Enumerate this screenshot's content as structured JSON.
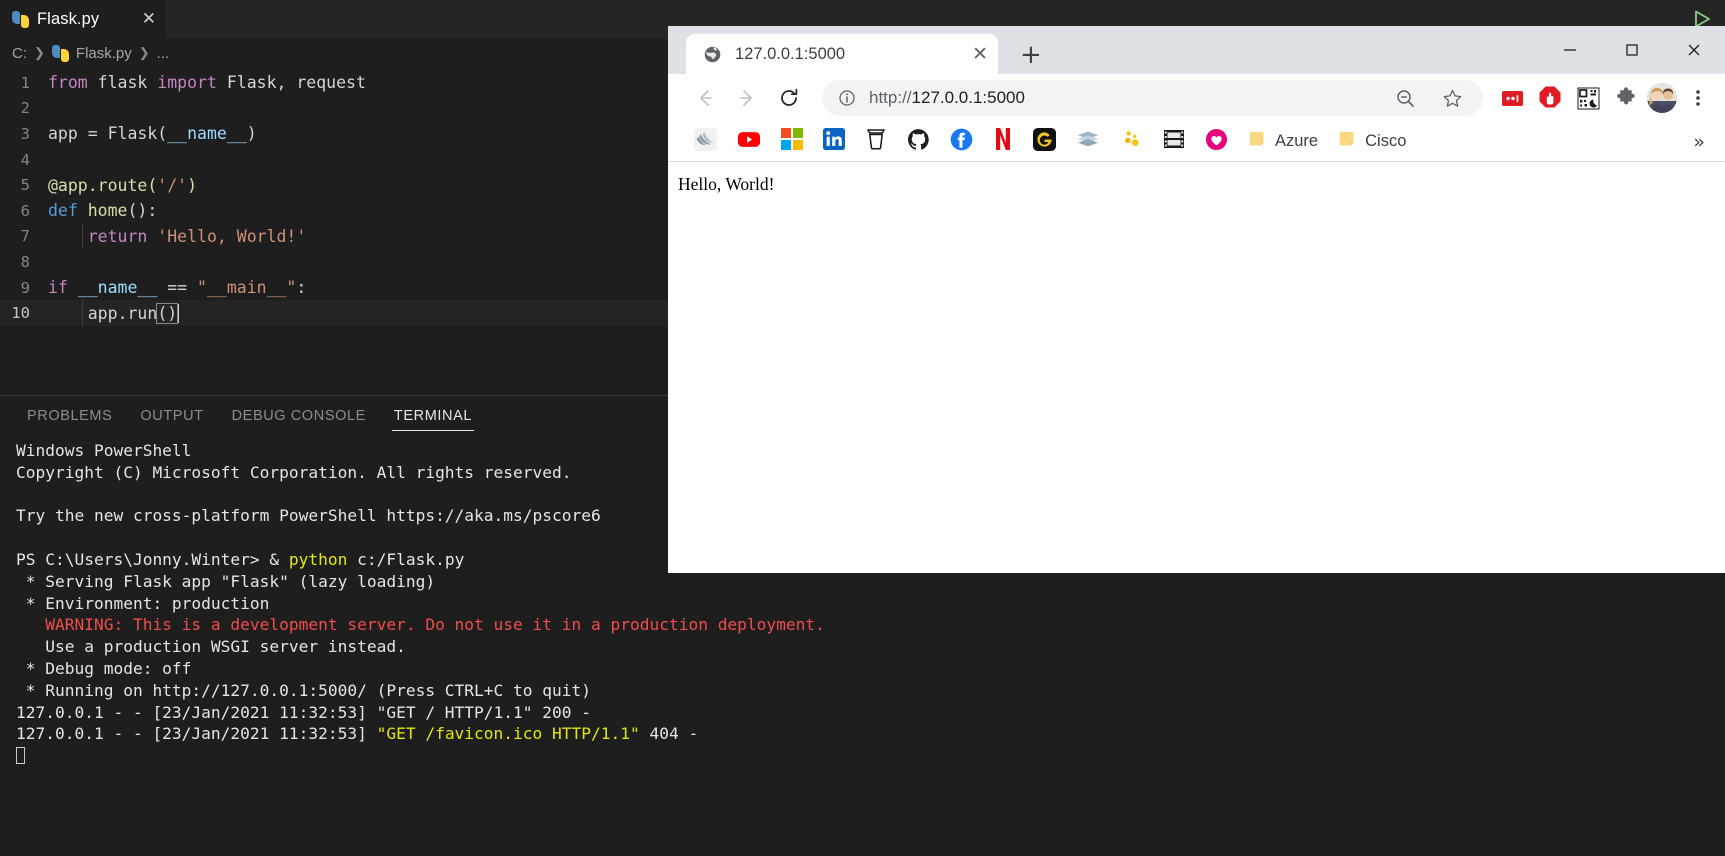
{
  "editor": {
    "tab": {
      "title": "Flask.py",
      "icon": "python-icon",
      "close_icon": "close-icon"
    },
    "run_icon": "run-play-icon",
    "breadcrumb": [
      "C:",
      "Flask.py",
      "..."
    ],
    "lines": [
      {
        "n": "1",
        "tokens": [
          {
            "t": "from ",
            "c": "kw"
          },
          {
            "t": "flask ",
            "c": "plain"
          },
          {
            "t": "import ",
            "c": "kw"
          },
          {
            "t": "Flask, request",
            "c": "plain"
          }
        ]
      },
      {
        "n": "2",
        "tokens": []
      },
      {
        "n": "3",
        "tokens": [
          {
            "t": "app ",
            "c": "plain"
          },
          {
            "t": "= ",
            "c": "plain"
          },
          {
            "t": "Flask(",
            "c": "plain"
          },
          {
            "t": "__name__",
            "c": "var"
          },
          {
            "t": ")",
            "c": "plain"
          }
        ]
      },
      {
        "n": "4",
        "tokens": []
      },
      {
        "n": "5",
        "tokens": [
          {
            "t": "@app.route(",
            "c": "fn"
          },
          {
            "t": "'/'",
            "c": "str"
          },
          {
            "t": ")",
            "c": "fn"
          }
        ]
      },
      {
        "n": "6",
        "tokens": [
          {
            "t": "def ",
            "c": "kw2"
          },
          {
            "t": "home",
            "c": "fn"
          },
          {
            "t": "():",
            "c": "plain"
          }
        ]
      },
      {
        "n": "7",
        "tokens": [
          {
            "t": "    ",
            "c": "plain"
          },
          {
            "t": "return ",
            "c": "kw"
          },
          {
            "t": "'Hello, World!'",
            "c": "str"
          }
        ]
      },
      {
        "n": "8",
        "tokens": []
      },
      {
        "n": "9",
        "tokens": [
          {
            "t": "if ",
            "c": "kw"
          },
          {
            "t": "__name__ ",
            "c": "var"
          },
          {
            "t": "== ",
            "c": "plain"
          },
          {
            "t": "\"__main__\"",
            "c": "str"
          },
          {
            "t": ":",
            "c": "plain"
          }
        ]
      },
      {
        "n": "10",
        "tokens": [
          {
            "t": "    ",
            "c": "plain"
          },
          {
            "t": "app",
            "c": "plain"
          },
          {
            "t": ".",
            "c": "plain"
          },
          {
            "t": "run",
            "c": "plain"
          }
        ],
        "active": true,
        "bracket": "()",
        "caret": true
      }
    ]
  },
  "panel": {
    "tabs": [
      {
        "label": "PROBLEMS",
        "active": false
      },
      {
        "label": "OUTPUT",
        "active": false
      },
      {
        "label": "DEBUG CONSOLE",
        "active": false
      },
      {
        "label": "TERMINAL",
        "active": true
      }
    ],
    "terminal_lines": [
      [
        {
          "t": "Windows PowerShell",
          "c": "white"
        }
      ],
      [
        {
          "t": "Copyright (C) Microsoft Corporation. All rights reserved.",
          "c": "white"
        }
      ],
      [],
      [
        {
          "t": "Try the new cross-platform PowerShell https://aka.ms/pscore6",
          "c": "white"
        }
      ],
      [],
      [
        {
          "t": "PS C:\\Users\\Jonny.Winter> & ",
          "c": "white"
        },
        {
          "t": "python",
          "c": "yellow"
        },
        {
          "t": " c:/Flask.py",
          "c": "white"
        }
      ],
      [
        {
          "t": " * Serving Flask app \"Flask\" (lazy loading)",
          "c": "white"
        }
      ],
      [
        {
          "t": " * Environment: production",
          "c": "white"
        }
      ],
      [
        {
          "t": "   WARNING: This is a development server. Do not use it in a production deployment.",
          "c": "red"
        }
      ],
      [
        {
          "t": "   Use a production WSGI server instead.",
          "c": "white"
        }
      ],
      [
        {
          "t": " * Debug mode: off",
          "c": "white"
        }
      ],
      [
        {
          "t": " * Running on http://127.0.0.1:5000/ (Press CTRL+C to quit)",
          "c": "white"
        }
      ],
      [
        {
          "t": "127.0.0.1 - - [23/Jan/2021 11:32:53] \"GET / HTTP/1.1\" 200 -",
          "c": "white"
        }
      ],
      [
        {
          "t": "127.0.0.1 - - [23/Jan/2021 11:32:53] ",
          "c": "white"
        },
        {
          "t": "\"GET /favicon.ico HTTP/1.1\"",
          "c": "yellow"
        },
        {
          "t": " 404 -",
          "c": "white"
        }
      ],
      [
        {
          "t": "CURSOR_BLOCK",
          "c": "block"
        }
      ]
    ]
  },
  "browser": {
    "tab": {
      "title": "127.0.0.1:5000",
      "favicon": "globe-icon",
      "close_icon": "close-icon"
    },
    "new_tab_label": "+",
    "window_controls": {
      "minimize": "—",
      "maximize": "☐",
      "close": "✕"
    },
    "toolbar": {
      "back_icon": "back-arrow-icon",
      "forward_icon": "forward-arrow-icon",
      "reload_icon": "reload-icon",
      "site_info_icon": "info-circle-icon",
      "url_scheme": "http://",
      "url_host": "127.0.0.1:5000",
      "zoom_icon": "zoom-out-magnifier-icon",
      "bookmark_icon": "star-icon",
      "ext_pocket_icon": "red-dots-extension-icon",
      "ext_adblock_icon": "adblock-stop-hand-icon",
      "ext_qr_icon": "qr-code-icon",
      "extensions_icon": "puzzle-piece-icon",
      "profile_icon": "profile-avatar",
      "menu_icon": "three-dot-menu-icon"
    },
    "bookmarks": [
      {
        "icon": "jquery-swirl-icon",
        "label": ""
      },
      {
        "icon": "youtube-icon",
        "label": ""
      },
      {
        "icon": "microsoft-icon",
        "label": ""
      },
      {
        "icon": "linkedin-icon",
        "label": ""
      },
      {
        "icon": "coffee-cup-icon",
        "label": ""
      },
      {
        "icon": "github-icon",
        "label": ""
      },
      {
        "icon": "facebook-icon",
        "label": ""
      },
      {
        "icon": "netflix-icon",
        "label": ""
      },
      {
        "icon": "grammarly-icon",
        "label": ""
      },
      {
        "icon": "stack-metal-icon",
        "label": ""
      },
      {
        "icon": "yellow-dots-icon",
        "label": ""
      },
      {
        "icon": "film-strip-icon",
        "label": ""
      },
      {
        "icon": "pink-heart-icon",
        "label": ""
      },
      {
        "icon": "folder-icon",
        "label": "Azure"
      },
      {
        "icon": "folder-icon",
        "label": "Cisco"
      }
    ],
    "bookmarks_overflow": "»",
    "page": {
      "body_text": "Hello, World!"
    }
  }
}
